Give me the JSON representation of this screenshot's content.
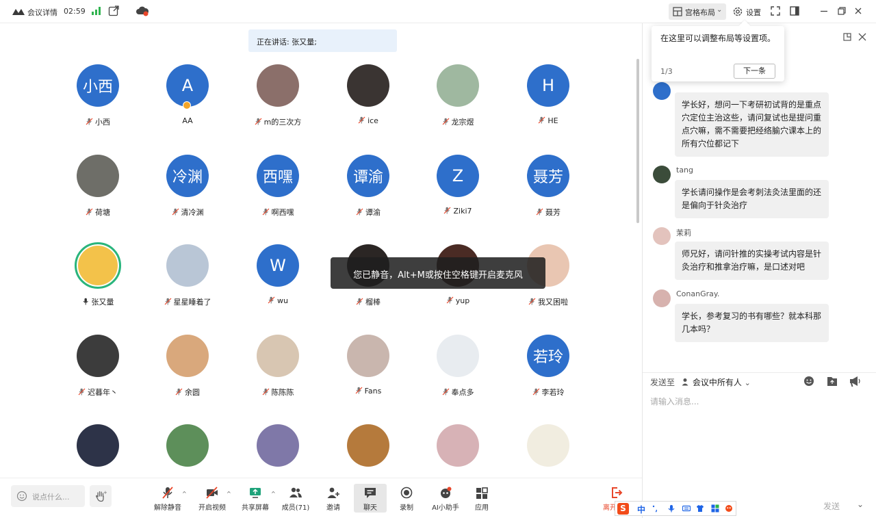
{
  "topbar": {
    "title": "会议详情",
    "time": "02:59",
    "layout_label": "宫格布局",
    "settings_label": "设置"
  },
  "speaking": {
    "label": "正在讲话: 张又量;"
  },
  "participants": [
    {
      "name": "小西",
      "avatar_text": "小西",
      "avatar_type": "text"
    },
    {
      "name": "AA",
      "avatar_text": "A",
      "avatar_type": "text",
      "badge": true
    },
    {
      "name": "m的三次方",
      "avatar_type": "photo",
      "photo_color": "#8b6f6a"
    },
    {
      "name": "ice",
      "avatar_type": "photo",
      "photo_color": "#3a3432"
    },
    {
      "name": "龙宗煜",
      "avatar_type": "photo",
      "photo_color": "#9fb8a0"
    },
    {
      "name": "HE",
      "avatar_text": "H",
      "avatar_type": "text"
    },
    {
      "name": "荷塘",
      "avatar_type": "photo",
      "photo_color": "#6e6e68"
    },
    {
      "name": "清冷渊",
      "avatar_text": "冷渊",
      "avatar_type": "text"
    },
    {
      "name": "啊西嘿",
      "avatar_text": "西嘿",
      "avatar_type": "text"
    },
    {
      "name": "谭渝",
      "avatar_text": "谭渝",
      "avatar_type": "text"
    },
    {
      "name": "Ziki7",
      "avatar_text": "Z",
      "avatar_type": "text"
    },
    {
      "name": "聂芳",
      "avatar_text": "聂芳",
      "avatar_type": "text"
    },
    {
      "name": "张又量",
      "avatar_type": "photo",
      "photo_color": "#f3c24a",
      "speaking": true
    },
    {
      "name": "星星睡着了",
      "avatar_type": "photo",
      "photo_color": "#b9c6d6"
    },
    {
      "name": "wu",
      "avatar_text": "W",
      "avatar_type": "text"
    },
    {
      "name": "榴棒",
      "avatar_type": "photo",
      "photo_color": "#2b2624"
    },
    {
      "name": "yup",
      "avatar_type": "photo",
      "photo_color": "#4a2b24"
    },
    {
      "name": "我又困啦",
      "avatar_type": "photo",
      "photo_color": "#e9c6b2"
    },
    {
      "name": "迟暮年丶",
      "avatar_type": "photo",
      "photo_color": "#3c3c3c"
    },
    {
      "name": "余圆",
      "avatar_type": "photo",
      "photo_color": "#d9a87c"
    },
    {
      "name": "陈陈陈",
      "avatar_type": "photo",
      "photo_color": "#d8c6b2"
    },
    {
      "name": "Fans",
      "avatar_type": "photo",
      "photo_color": "#c9b6ae"
    },
    {
      "name": "奉点多",
      "avatar_type": "photo",
      "photo_color": "#e8ecf0"
    },
    {
      "name": "李若玲",
      "avatar_text": "若玲",
      "avatar_type": "text"
    },
    {
      "name": "",
      "avatar_type": "photo",
      "photo_color": "#2d3348"
    },
    {
      "name": "",
      "avatar_type": "photo",
      "photo_color": "#5d8f5a"
    },
    {
      "name": "",
      "avatar_type": "photo",
      "photo_color": "#7f78a8"
    },
    {
      "name": "",
      "avatar_type": "photo",
      "photo_color": "#b57a3c"
    },
    {
      "name": "",
      "avatar_type": "photo",
      "photo_color": "#d7b2b6"
    },
    {
      "name": "",
      "avatar_type": "photo",
      "photo_color": "#f1ede0"
    }
  ],
  "toast": {
    "label": "您已静音，Alt+M或按住空格键开启麦克风"
  },
  "bottombar": {
    "say_placeholder": "说点什么...",
    "tools": [
      {
        "label": "解除静音",
        "icon": "mic-off-icon"
      },
      {
        "label": "开启视频",
        "icon": "video-off-icon"
      },
      {
        "label": "共享屏幕",
        "icon": "share-screen-icon"
      },
      {
        "label": "成员(71)",
        "icon": "members-icon"
      },
      {
        "label": "邀请",
        "icon": "invite-icon"
      },
      {
        "label": "聊天",
        "icon": "chat-icon"
      },
      {
        "label": "录制",
        "icon": "record-icon"
      },
      {
        "label": "AI小助手",
        "icon": "ai-assistant-icon"
      },
      {
        "label": "应用",
        "icon": "apps-icon"
      }
    ],
    "leave_label": "离开会议"
  },
  "ime": {
    "lang": "中"
  },
  "panel": {
    "tooltip": {
      "text": "在这里可以调整布局等设置项。",
      "page": "1/3",
      "next_label": "下一条"
    },
    "messages": [
      {
        "sender": "",
        "text": "学长好，想问一下考研初试背的是重点穴定位主治这些，请问复试也是提问重点穴嘛，需不需要把经络腧穴课本上的所有穴位都记下"
      },
      {
        "sender": "tang",
        "text": "学长请问操作是会考刺法灸法里面的还是偏向于针灸治疗"
      },
      {
        "sender": "茉莉",
        "text": "师兄好，请问针推的实操考试内容是针灸治疗和推拿治疗嘛，是口述对吧"
      },
      {
        "sender": "ConanGray.",
        "text": "学长，参考复习的书有哪些？就本科那几本吗？"
      }
    ],
    "send_to_label": "发送至",
    "send_to_target": "会议中所有人",
    "input_placeholder": "请输入消息...",
    "send_label": "发送"
  },
  "colors": {
    "avatar_blue": "#2e6fcb",
    "leave_red": "#e8462a",
    "speaking_banner": "#e8f1fb",
    "speaking_ring": "#29b57e"
  }
}
